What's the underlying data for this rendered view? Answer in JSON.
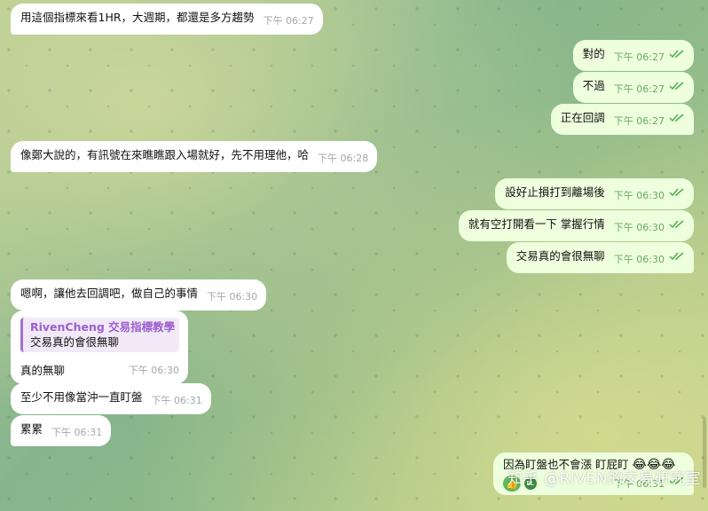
{
  "messages": [
    {
      "side": "in",
      "text": "用這個指標來看1HR，大週期，都還是多方趨勢",
      "time": "下午 06:27"
    },
    {
      "side": "out",
      "text": "對的",
      "time": "下午 06:27"
    },
    {
      "side": "out",
      "text": "不過",
      "time": "下午 06:27"
    },
    {
      "side": "out",
      "text": "正在回調",
      "time": "下午 06:27"
    },
    {
      "side": "in",
      "text": "像鄭大說的，有訊號在來瞧瞧跟入場就好，先不用理他，哈",
      "time": "下午 06:28"
    },
    {
      "side": "out",
      "text": "設好止損打到離場後",
      "time": "下午 06:30"
    },
    {
      "side": "out",
      "text": "就有空打開看一下 掌握行情",
      "time": "下午 06:30"
    },
    {
      "side": "out",
      "text": "交易真的會很無聊",
      "time": "下午 06:30"
    },
    {
      "side": "in",
      "text": "嗯啊，讓他去回調吧，做自己的事情",
      "time": "下午 06:30"
    },
    {
      "side": "in",
      "reply_name": "RivenCheng 交易指標教學",
      "reply_text": "交易真的會很無聊",
      "text": "真的無聊",
      "time": "下午 06:30"
    },
    {
      "side": "in",
      "text": "至少不用像當沖一直盯盤",
      "time": "下午 06:31"
    },
    {
      "side": "in",
      "text": "累累",
      "time": "下午 06:31"
    },
    {
      "side": "out",
      "text": "因為盯盤也不會漲 盯屁盯",
      "emoji": "😂😂😂",
      "reaction_emoji": "👍",
      "reaction_avatar": "BL",
      "time": "下午 06:31"
    }
  ],
  "watermark": "知乎 @RIVEN的交易研究室",
  "colors": {
    "incoming": "#ffffff",
    "outgoing": "#eeffde",
    "read_check": "#4fae4e",
    "reply_accent": "#a56fd1"
  }
}
